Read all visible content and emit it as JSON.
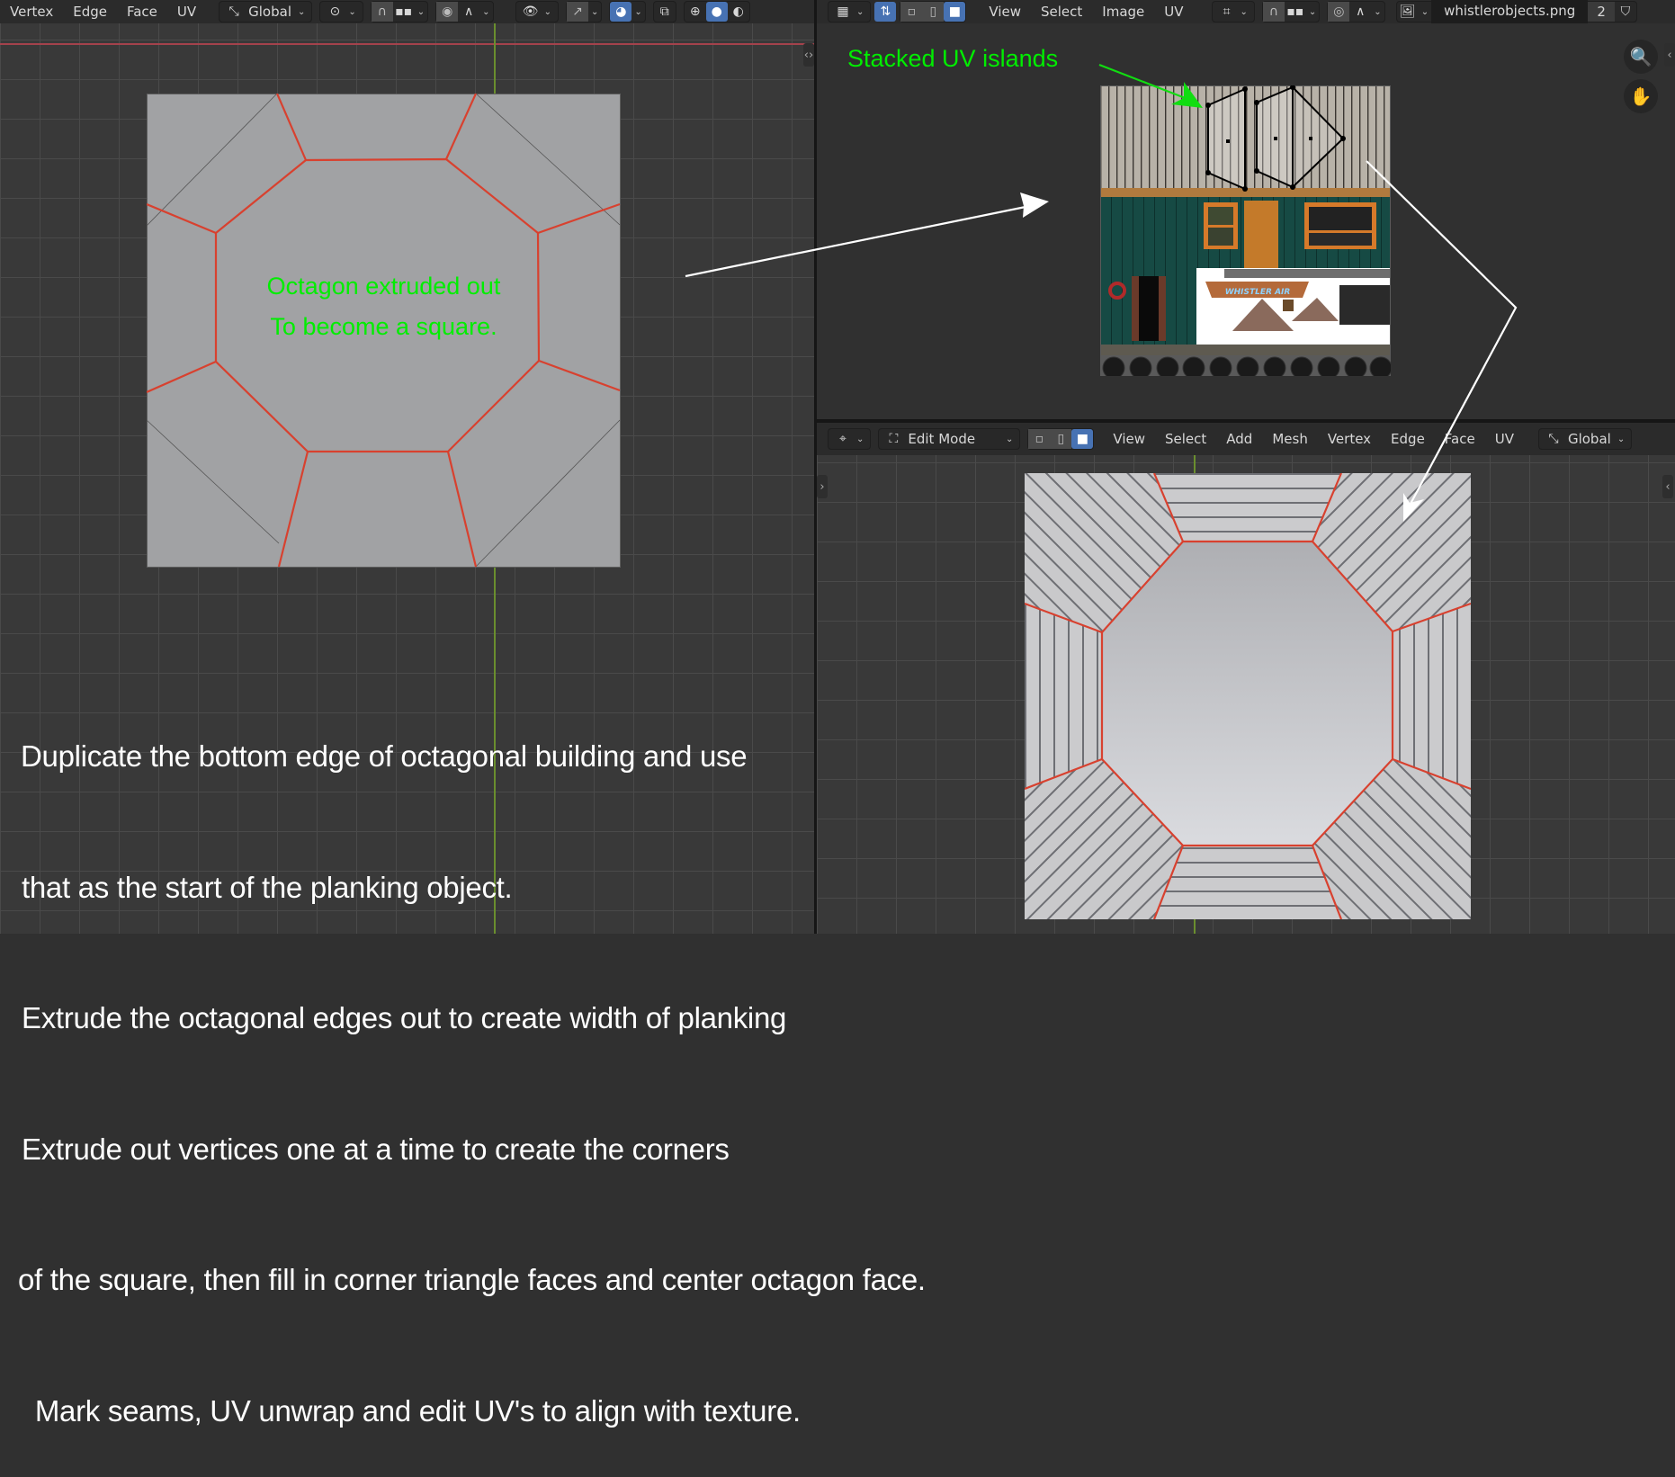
{
  "left_header": {
    "menus": [
      "Vertex",
      "Edge",
      "Face",
      "UV"
    ],
    "orientation": "Global",
    "icons": [
      "transform-orientation-icon",
      "pivot-icon",
      "snap-magnet-icon",
      "snap-target-icon",
      "proportional-icon",
      "falloff-icon",
      "visibility-icon",
      "gizmo-icon",
      "overlay-icon",
      "xray-icon",
      "wireframe-shading-icon",
      "solid-shading-icon"
    ]
  },
  "uv_header": {
    "menus": [
      "View",
      "Select",
      "Image",
      "UV"
    ],
    "image_name": "whistlerobjects.png",
    "user_count": "2",
    "icons": [
      "editor-type-icon",
      "sync-selection-icon",
      "vertex-select-icon",
      "edge-select-icon",
      "face-select-icon",
      "pivot-icon",
      "snap-magnet-icon",
      "snap-increment-icon",
      "proportional-icon",
      "falloff-icon",
      "image-browse-icon",
      "fake-user-shield-icon"
    ]
  },
  "bottom_header": {
    "mode": "Edit Mode",
    "menus": [
      "View",
      "Select",
      "Add",
      "Mesh",
      "Vertex",
      "Edge",
      "Face",
      "UV"
    ],
    "orientation": "Global"
  },
  "annotations": {
    "stacked_uv": "Stacked UV islands",
    "octagon_line1": "Octagon extruded out",
    "octagon_line2": "To become a square.",
    "instructions": [
      "Duplicate the bottom edge of octagonal building and use",
      "that as the start of the planking object.",
      "Extrude the octagonal edges out to create width of planking",
      "Extrude out vertices one at a time to create the corners",
      "of the square, then fill in corner triangle faces and center octagon face.",
      " Mark seams, UV unwrap and edit UV's to align with texture."
    ]
  },
  "texture": {
    "sign_text": "WHISTLER AIR"
  },
  "colors": {
    "accent": "#4772b3",
    "seam": "#e0392b",
    "annotation_green": "#00ee00",
    "annotation_white": "#ffffff"
  }
}
